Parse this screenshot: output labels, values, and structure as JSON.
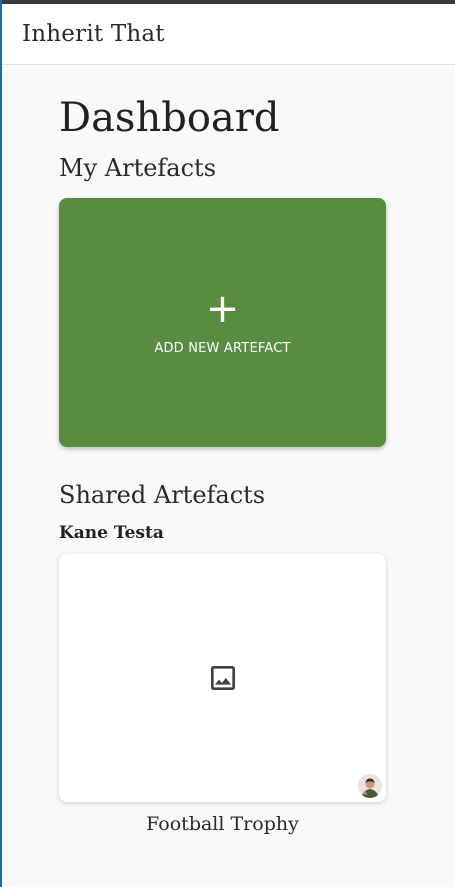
{
  "app": {
    "title": "Inherit That"
  },
  "dashboard": {
    "title": "Dashboard",
    "my_artefacts": {
      "heading": "My Artefacts",
      "add_card": {
        "icon": "plus-icon",
        "plus_glyph": "+",
        "label": "ADD NEW ARTEFACT",
        "color": "#598b40"
      }
    },
    "shared_artefacts": {
      "heading": "Shared Artefacts",
      "groups": [
        {
          "owner": "Kane Testa",
          "artefacts": [
            {
              "name": "Football Trophy",
              "thumbnail_icon": "image-placeholder-icon",
              "avatar": "owner-avatar"
            }
          ]
        }
      ]
    }
  }
}
